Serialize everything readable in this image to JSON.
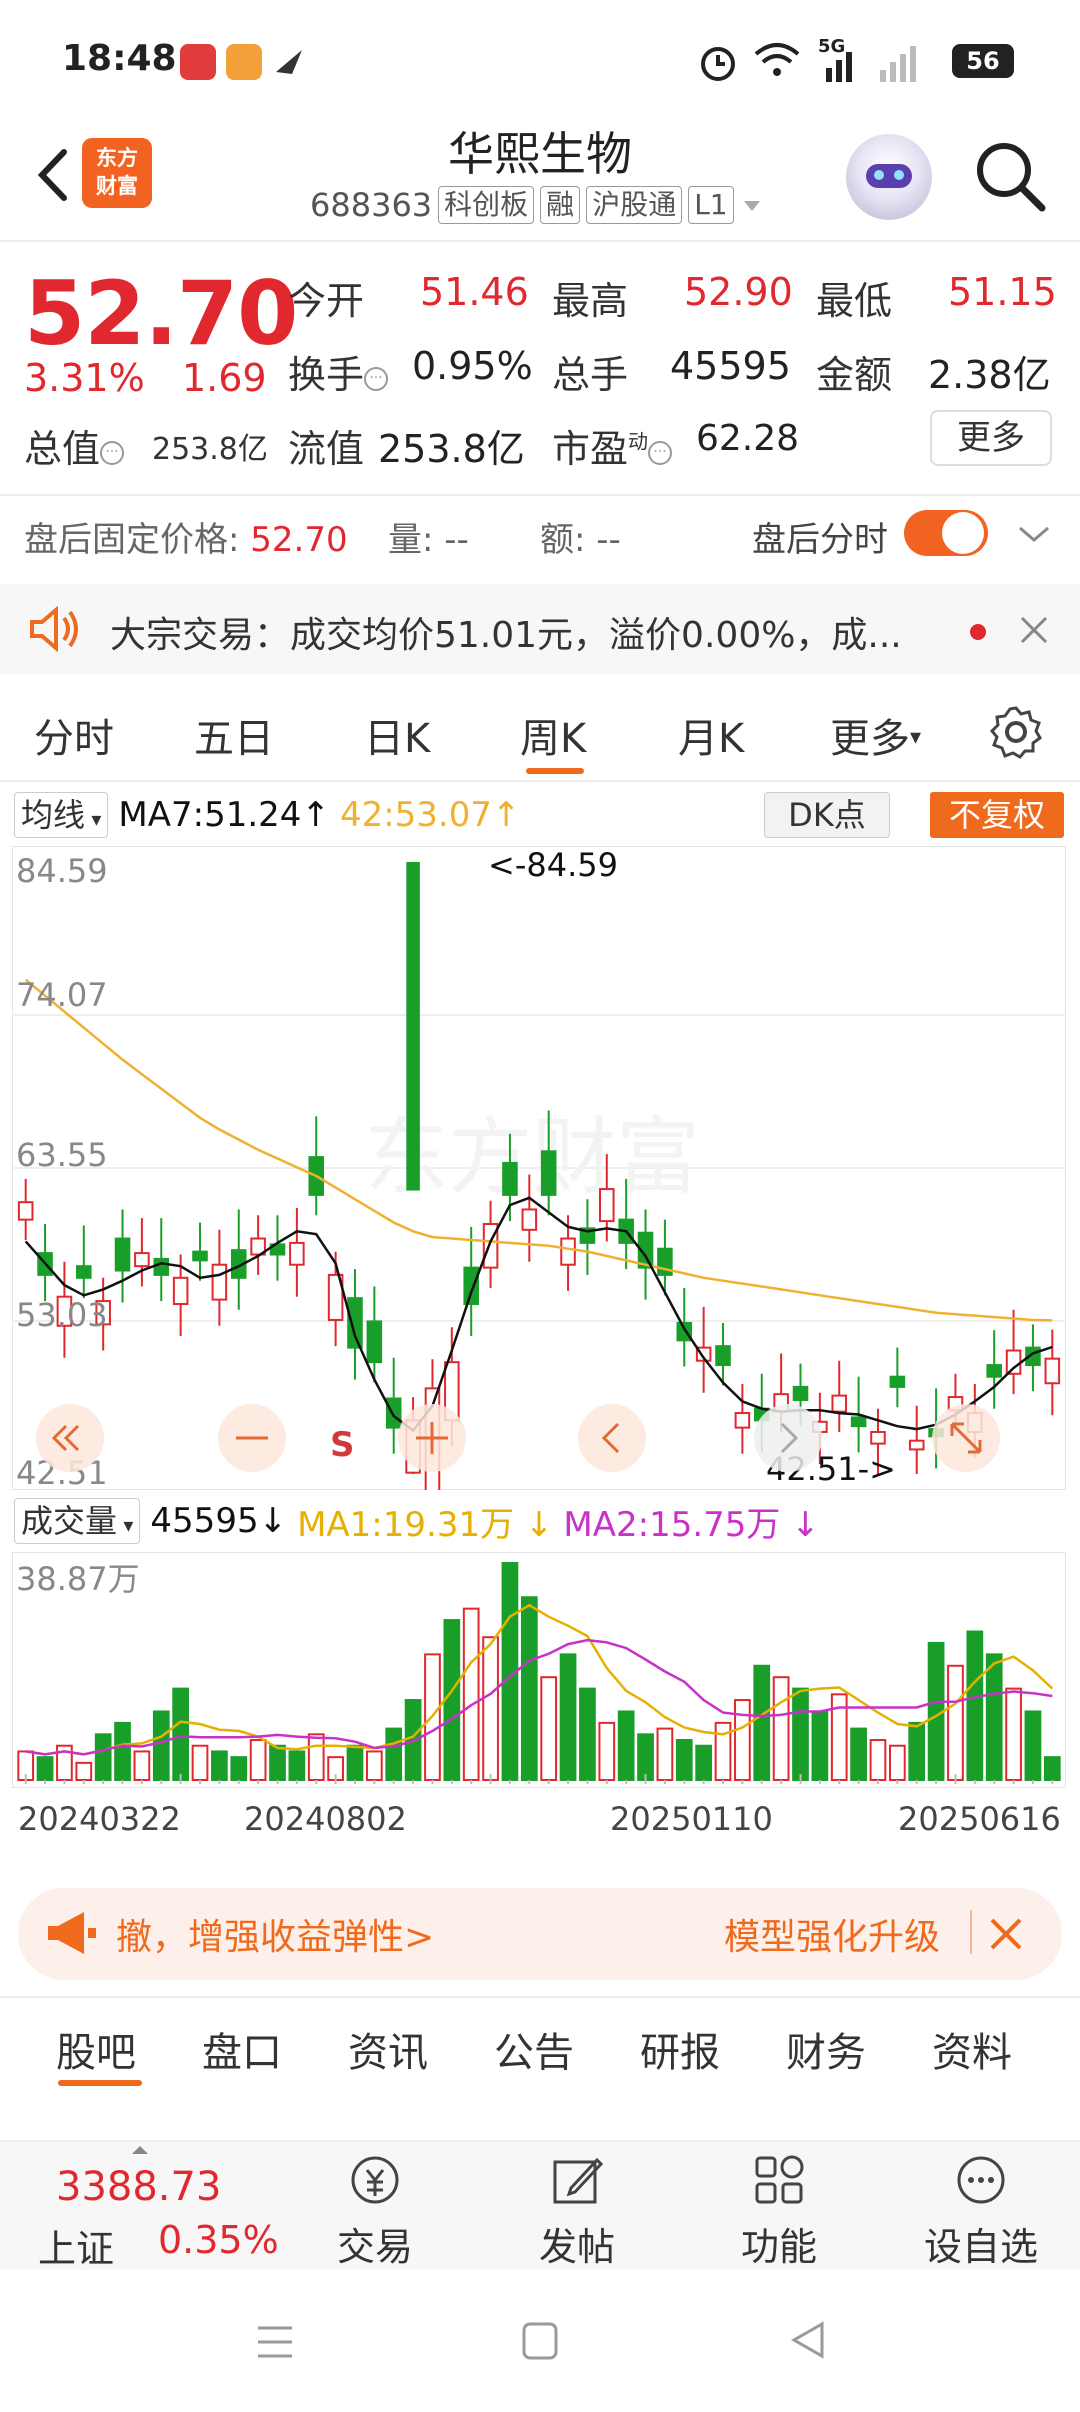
{
  "status_bar": {
    "time": "18:48",
    "battery": "56",
    "network": "5G"
  },
  "header": {
    "logo_line1": "东方",
    "logo_line2": "财富",
    "stock_name": "华熙生物",
    "code": "688363",
    "tags": [
      "科创板",
      "融",
      "沪股通",
      "L1"
    ]
  },
  "quote": {
    "price": "52.70",
    "change_pct": "3.31%",
    "change": "1.69",
    "open_label": "今开",
    "open": "51.46",
    "high_label": "最高",
    "high": "52.90",
    "low_label": "最低",
    "low": "51.15",
    "turnover_label": "换手",
    "turnover": "0.95%",
    "volume_label": "总手",
    "volume": "45595",
    "amount_label": "金额",
    "amount": "2.38亿",
    "mcap_label": "总值",
    "mcap": "253.8亿",
    "float_label": "流值",
    "float": "253.8亿",
    "pe_label": "市盈",
    "pe_sup": "动",
    "pe": "62.28",
    "more_label": "更多"
  },
  "after_hours": {
    "price_label": "盘后固定价格:",
    "price": "52.70",
    "vol_label": "量:",
    "vol": "--",
    "amt_label": "额:",
    "amt": "--",
    "timeshare_label": "盘后分时"
  },
  "block_trade": {
    "text": "大宗交易：成交均价51.01元，溢价0.00%，成..."
  },
  "tabs": [
    "分时",
    "五日",
    "日K",
    "周K",
    "月K",
    "更多"
  ],
  "active_tab": "周K",
  "ma_bar": {
    "select_label": "均线",
    "ma7": "MA7:51.24↑",
    "ma42": "42:53.07↑",
    "dk_label": "DK点",
    "fq_label": "不复权"
  },
  "kchart": {
    "y_labels": [
      "84.59",
      "74.07",
      "63.55",
      "53.03",
      "42.51"
    ],
    "max_marker": "<-84.59",
    "min_marker": "42.51->",
    "s_marker": "S"
  },
  "vol_bar": {
    "select_label": "成交量",
    "vol": "45595↓",
    "ma1": "MA1:19.31万 ↓",
    "ma2": "MA2:15.75万 ↓",
    "max_label": "38.87万"
  },
  "dates": [
    "20240322",
    "20240802",
    "20250110",
    "20250616"
  ],
  "promo": {
    "left": "撤，增强收益弹性>",
    "right": "模型强化升级"
  },
  "bottom_tabs": [
    "股吧",
    "盘口",
    "资讯",
    "公告",
    "研报",
    "财务",
    "资料"
  ],
  "active_bottom_tab": "股吧",
  "index": {
    "value": "3388.73",
    "name": "上证",
    "pct": "0.35%"
  },
  "nav": [
    "交易",
    "发帖",
    "功能",
    "设自选"
  ],
  "colors": {
    "up": "#e0282e",
    "down": "#1a9e2a",
    "accent": "#f06a1e",
    "ma7": "#111111",
    "ma42": "#f0b030",
    "ma1": "#e6b000",
    "ma2": "#c832c8"
  },
  "chart_data": {
    "type": "candlestick",
    "period": "weekly",
    "ylim": [
      42.51,
      84.59
    ],
    "series": [
      {
        "name": "MA7",
        "values": [
          58.5,
          57.0,
          55.5,
          54.8,
          55.2,
          55.8,
          56.5,
          57.0,
          56.8,
          56.0,
          56.2,
          56.8,
          57.5,
          58.4,
          59.2,
          59.0,
          57.0,
          52.0,
          49.0,
          46.5,
          45.5,
          47.2,
          51.0,
          55.0,
          58.5,
          61.0,
          61.5,
          60.5,
          59.5,
          59.2,
          59.4,
          59.2,
          57.5,
          55.0,
          52.5,
          50.5,
          48.8,
          47.5,
          47.0,
          46.8,
          46.9,
          46.9,
          46.7,
          46.6,
          46.2,
          45.8,
          45.6,
          45.9,
          46.6,
          47.5,
          48.5,
          49.8,
          50.8,
          51.24
        ]
      },
      {
        "name": "MA42",
        "values": [
          76.5,
          75.4,
          74.3,
          73.2,
          72.1,
          71.0,
          70.0,
          69.0,
          68.0,
          67.0,
          66.2,
          65.5,
          64.8,
          64.2,
          63.6,
          63.0,
          62.2,
          61.4,
          60.6,
          59.8,
          59.2,
          58.8,
          58.7,
          58.6,
          58.5,
          58.4,
          58.3,
          58.2,
          58.0,
          57.8,
          57.5,
          57.2,
          56.9,
          56.6,
          56.3,
          56.0,
          55.8,
          55.6,
          55.4,
          55.2,
          55.0,
          54.8,
          54.6,
          54.4,
          54.2,
          54.0,
          53.8,
          53.6,
          53.5,
          53.4,
          53.3,
          53.2,
          53.1,
          53.07
        ]
      }
    ],
    "volume_ylim_wan": [
      0,
      38.87
    ]
  }
}
